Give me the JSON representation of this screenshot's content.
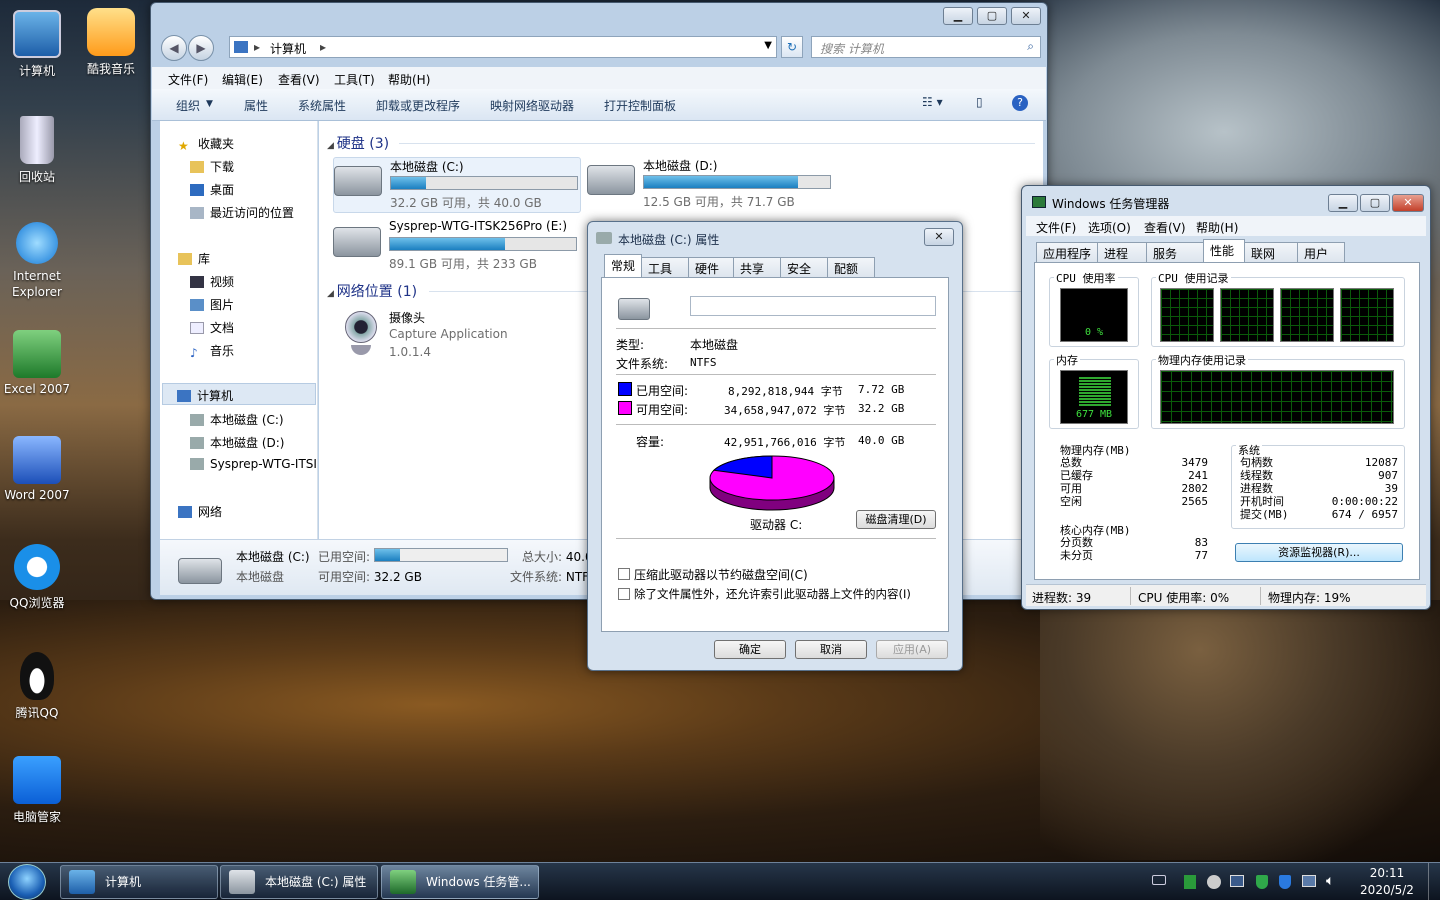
{
  "desktop": {
    "icons": [
      {
        "label": "计算机"
      },
      {
        "label": "酷我音乐"
      },
      {
        "label": "回收站"
      },
      {
        "label": "Internet Explorer"
      },
      {
        "label": "Excel 2007"
      },
      {
        "label": "Word 2007"
      },
      {
        "label": "QQ浏览器"
      },
      {
        "label": "腾讯QQ"
      },
      {
        "label": "电脑管家"
      }
    ]
  },
  "explorer": {
    "address": "计算机",
    "search_placeholder": "搜索 计算机",
    "menu": [
      "文件(F)",
      "编辑(E)",
      "查看(V)",
      "工具(T)",
      "帮助(H)"
    ],
    "commands": {
      "organize": "组织",
      "properties": "属性",
      "system_properties": "系统属性",
      "uninstall": "卸载或更改程序",
      "map_drive": "映射网络驱动器",
      "control_panel": "打开控制面板"
    },
    "nav": {
      "favorites": "收藏夹",
      "downloads": "下载",
      "desktop": "桌面",
      "recent": "最近访问的位置",
      "libraries": "库",
      "videos": "视频",
      "pictures": "图片",
      "documents": "文档",
      "music": "音乐",
      "computer": "计算机",
      "drive_c": "本地磁盘 (C:)",
      "drive_d": "本地磁盘 (D:)",
      "drive_e": "Sysprep-WTG-ITSI",
      "network": "网络"
    },
    "section_drives": "硬盘 (3)",
    "section_network": "网络位置 (1)",
    "drives": [
      {
        "name": "本地磁盘 (C:)",
        "info": "32.2 GB 可用，共 40.0 GB",
        "used_fraction": 0.19
      },
      {
        "name": "本地磁盘 (D:)",
        "info": "12.5 GB 可用，共 71.7 GB",
        "used_fraction": 0.83
      },
      {
        "name": "Sysprep-WTG-ITSK256Pro (E:)",
        "info": "89.1 GB 可用，共 233 GB",
        "used_fraction": 0.62
      }
    ],
    "camera": {
      "name": "摄像头",
      "app": "Capture Application",
      "version": "1.0.1.4"
    },
    "details": {
      "name": "本地磁盘 (C:)",
      "type": "本地磁盘",
      "used_label": "已用空间:",
      "free_label": "可用空间:",
      "free_value": "32.2 GB",
      "total_label": "总大小:",
      "total_value": "40.0",
      "fs_label": "文件系统:",
      "fs_value": "NTF",
      "used_fraction": 0.19
    }
  },
  "props": {
    "title": "本地磁盘 (C:) 属性",
    "tabs": [
      "常规",
      "工具",
      "硬件",
      "共享",
      "安全",
      "配额"
    ],
    "type_label": "类型:",
    "type_value": "本地磁盘",
    "fs_label": "文件系统:",
    "fs_value": "NTFS",
    "used_label": "已用空间:",
    "used_bytes": "8,292,818,944 字节",
    "used_gb": "7.72 GB",
    "free_label": "可用空间:",
    "free_bytes": "34,658,947,072 字节",
    "free_gb": "32.2 GB",
    "cap_label": "容量:",
    "cap_bytes": "42,951,766,016 字节",
    "cap_gb": "40.0 GB",
    "drive_label": "驱动器 C:",
    "cleanup": "磁盘清理(D)",
    "compress": "压缩此驱动器以节约磁盘空间(C)",
    "index": "除了文件属性外，还允许索引此驱动器上文件的内容(I)",
    "ok": "确定",
    "cancel": "取消",
    "apply": "应用(A)",
    "used_color": "#0000ff",
    "free_color": "#ff00ff",
    "used_fraction": 0.193
  },
  "taskmgr": {
    "title": "Windows 任务管理器",
    "menu": [
      "文件(F)",
      "选项(O)",
      "查看(V)",
      "帮助(H)"
    ],
    "tabs": [
      "应用程序",
      "进程",
      "服务",
      "性能",
      "联网",
      "用户"
    ],
    "cpu_label": "CPU 使用率",
    "cpu_history_label": "CPU 使用记录",
    "cpu_value": "0 %",
    "mem_label": "内存",
    "mem_history_label": "物理内存使用记录",
    "mem_value": "677 MB",
    "phys": {
      "title": "物理内存(MB)",
      "rows": [
        {
          "k": "总数",
          "v": "3479"
        },
        {
          "k": "已缓存",
          "v": "241"
        },
        {
          "k": "可用",
          "v": "2802"
        },
        {
          "k": "空闲",
          "v": "2565"
        }
      ]
    },
    "kernel": {
      "title": "核心内存(MB)",
      "rows": [
        {
          "k": "分页数",
          "v": "83"
        },
        {
          "k": "未分页",
          "v": "77"
        }
      ]
    },
    "system": {
      "title": "系统",
      "rows": [
        {
          "k": "句柄数",
          "v": "12087"
        },
        {
          "k": "线程数",
          "v": "907"
        },
        {
          "k": "进程数",
          "v": "39"
        },
        {
          "k": "开机时间",
          "v": "0:00:00:22"
        },
        {
          "k": "提交(MB)",
          "v": "674 / 6957"
        }
      ]
    },
    "resmon": "资源监视器(R)...",
    "status": {
      "processes": "进程数: 39",
      "cpu": "CPU 使用率: 0%",
      "mem": "物理内存: 19%"
    }
  },
  "taskbar": {
    "buttons": [
      {
        "label": "计算机"
      },
      {
        "label": "本地磁盘 (C:) 属性"
      },
      {
        "label": "Windows 任务管..."
      }
    ],
    "time": "20:11",
    "date": "2020/5/2"
  }
}
